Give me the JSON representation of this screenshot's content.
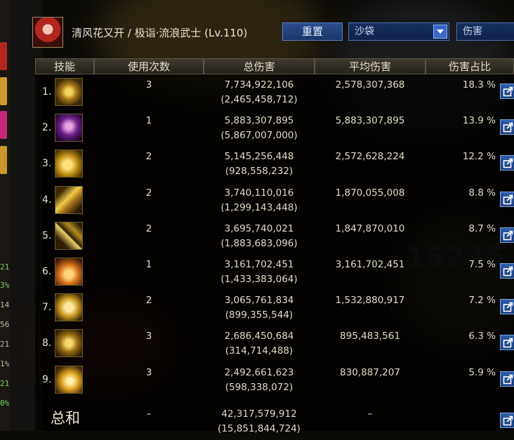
{
  "header": {
    "character": "清风花又开 / 极诣·流浪武士 (Lv.110)",
    "reset_button": "重置",
    "target_select": "沙袋",
    "metric_select": "伤害"
  },
  "table": {
    "columns": [
      "技能",
      "使用次数",
      "总伤害",
      "平均伤害",
      "伤害占比"
    ],
    "rows": [
      {
        "rank": "1.",
        "icon": "skill-icon-golden-shards",
        "uses": "3",
        "total": "7,734,922,106",
        "total_sub": "(2,465,458,712)",
        "avg": "2,578,307,368",
        "pct": "18.3 %"
      },
      {
        "rank": "2.",
        "icon": "skill-icon-purple-warrior",
        "uses": "1",
        "total": "5,883,307,895",
        "total_sub": "(5,867,007,000)",
        "avg": "5,883,307,895",
        "pct": "13.9 %"
      },
      {
        "rank": "3.",
        "icon": "skill-icon-golden-swirl",
        "uses": "2",
        "total": "5,145,256,448",
        "total_sub": "(928,558,232)",
        "avg": "2,572,628,224",
        "pct": "12.2 %"
      },
      {
        "rank": "4.",
        "icon": "skill-icon-golden-slash",
        "uses": "2",
        "total": "3,740,110,016",
        "total_sub": "(1,299,143,448)",
        "avg": "1,870,055,008",
        "pct": "8.8 %"
      },
      {
        "rank": "5.",
        "icon": "skill-icon-cross-slash",
        "uses": "2",
        "total": "3,695,740,021",
        "total_sub": "(1,883,683,096)",
        "avg": "1,847,870,010",
        "pct": "8.7 %"
      },
      {
        "rank": "6.",
        "icon": "skill-icon-orange-burst",
        "uses": "1",
        "total": "3,161,702,451",
        "total_sub": "(1,433,383,064)",
        "avg": "3,161,702,451",
        "pct": "7.5 %"
      },
      {
        "rank": "7.",
        "icon": "skill-icon-golden-palm",
        "uses": "2",
        "total": "3,065,761,834",
        "total_sub": "(899,355,544)",
        "avg": "1,532,880,917",
        "pct": "7.2 %"
      },
      {
        "rank": "8.",
        "icon": "skill-icon-golden-sword",
        "uses": "3",
        "total": "2,686,450,684",
        "total_sub": "(314,714,488)",
        "avg": "895,483,561",
        "pct": "6.3 %"
      },
      {
        "rank": "9.",
        "icon": "skill-icon-golden-explosion",
        "uses": "3",
        "total": "2,492,661,623",
        "total_sub": "(598,338,072)",
        "avg": "830,887,207",
        "pct": "5.9 %"
      }
    ],
    "summary": {
      "label": "总和",
      "uses": "–",
      "total": "42,317,579,912",
      "total_sub": "(15,851,844,724)",
      "avg": "–"
    }
  },
  "background": {
    "ghost_text": "15235"
  },
  "side_panel": {
    "values": [
      "21",
      "3%",
      "14",
      "56",
      "21",
      "1%",
      "21",
      "0%"
    ]
  },
  "colors": {
    "accent_blue": "#2d5ca8",
    "header_bar": "#3f3a30",
    "text": "#e2dac7"
  }
}
